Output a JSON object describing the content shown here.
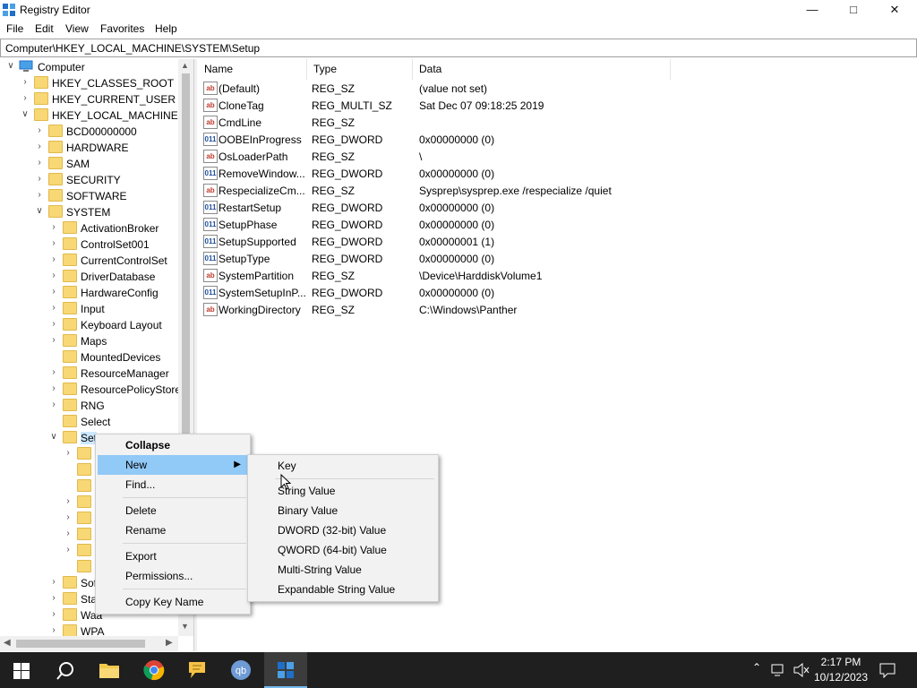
{
  "window": {
    "title": "Registry Editor"
  },
  "menu": [
    "File",
    "Edit",
    "View",
    "Favorites",
    "Help"
  ],
  "address": "Computer\\HKEY_LOCAL_MACHINE\\SYSTEM\\Setup",
  "tree": {
    "root": "Computer",
    "hives": [
      "HKEY_CLASSES_ROOT",
      "HKEY_CURRENT_USER",
      "HKEY_LOCAL_MACHINE"
    ],
    "hklm_children": [
      "BCD00000000",
      "HARDWARE",
      "SAM",
      "SECURITY",
      "SOFTWARE",
      "SYSTEM"
    ],
    "system_children": [
      "ActivationBroker",
      "ControlSet001",
      "CurrentControlSet",
      "DriverDatabase",
      "HardwareConfig",
      "Input",
      "Keyboard Layout",
      "Maps",
      "MountedDevices",
      "ResourceManager",
      "ResourcePolicyStore",
      "RNG",
      "Select",
      "Set",
      "Sof",
      "Sta",
      "Waa",
      "WPA"
    ]
  },
  "columns": {
    "name": "Name",
    "type": "Type",
    "data": "Data"
  },
  "values": [
    {
      "icon": "string-value-icon",
      "name": "(Default)",
      "type": "REG_SZ",
      "data": "(value not set)"
    },
    {
      "icon": "string-value-icon",
      "name": "CloneTag",
      "type": "REG_MULTI_SZ",
      "data": "Sat Dec 07 09:18:25 2019"
    },
    {
      "icon": "string-value-icon",
      "name": "CmdLine",
      "type": "REG_SZ",
      "data": ""
    },
    {
      "icon": "binary-value-icon",
      "name": "OOBEInProgress",
      "type": "REG_DWORD",
      "data": "0x00000000 (0)"
    },
    {
      "icon": "string-value-icon",
      "name": "OsLoaderPath",
      "type": "REG_SZ",
      "data": "\\"
    },
    {
      "icon": "binary-value-icon",
      "name": "RemoveWindow...",
      "type": "REG_DWORD",
      "data": "0x00000000 (0)"
    },
    {
      "icon": "string-value-icon",
      "name": "RespecializeCm...",
      "type": "REG_SZ",
      "data": "Sysprep\\sysprep.exe /respecialize /quiet"
    },
    {
      "icon": "binary-value-icon",
      "name": "RestartSetup",
      "type": "REG_DWORD",
      "data": "0x00000000 (0)"
    },
    {
      "icon": "binary-value-icon",
      "name": "SetupPhase",
      "type": "REG_DWORD",
      "data": "0x00000000 (0)"
    },
    {
      "icon": "binary-value-icon",
      "name": "SetupSupported",
      "type": "REG_DWORD",
      "data": "0x00000001 (1)"
    },
    {
      "icon": "binary-value-icon",
      "name": "SetupType",
      "type": "REG_DWORD",
      "data": "0x00000000 (0)"
    },
    {
      "icon": "string-value-icon",
      "name": "SystemPartition",
      "type": "REG_SZ",
      "data": "\\Device\\HarddiskVolume1"
    },
    {
      "icon": "binary-value-icon",
      "name": "SystemSetupInP...",
      "type": "REG_DWORD",
      "data": "0x00000000 (0)"
    },
    {
      "icon": "string-value-icon",
      "name": "WorkingDirectory",
      "type": "REG_SZ",
      "data": "C:\\Windows\\Panther"
    }
  ],
  "context_menu": [
    "Collapse",
    "New",
    "Find...",
    "Delete",
    "Rename",
    "Export",
    "Permissions...",
    "Copy Key Name"
  ],
  "new_submenu": [
    "Key",
    "String Value",
    "Binary Value",
    "DWORD (32-bit) Value",
    "QWORD (64-bit) Value",
    "Multi-String Value",
    "Expandable String Value"
  ],
  "taskbar": {
    "time": "2:17 PM",
    "date": "10/12/2023"
  },
  "colors": {
    "highlight": "#91c9f7",
    "taskbar": "#1f1f1f",
    "folder": "#f8d775"
  }
}
